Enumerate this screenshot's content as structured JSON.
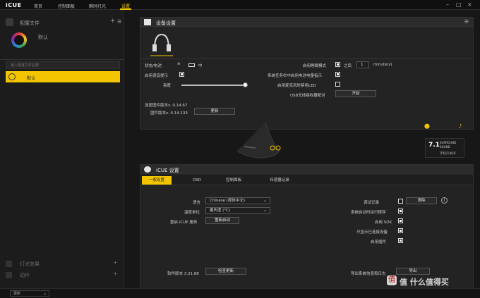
{
  "app": {
    "logo": "iCUE"
  },
  "nav": {
    "items": [
      "首页",
      "控制面板",
      "瞬时灯光",
      "设置"
    ],
    "active_index": 3
  },
  "window": {
    "minimize": "–",
    "maximize": "□",
    "close": "×"
  },
  "sidebar": {
    "header": "配置文件",
    "profile_name": "默认",
    "search_placeholder": "输入配置文件名称",
    "items": [
      {
        "label": "默认",
        "selected": true
      }
    ],
    "sections": [
      "灯光效果",
      "动作"
    ]
  },
  "bottom": {
    "update_label": "更新"
  },
  "device_panel": {
    "title": "设备设置",
    "status_label": "状态/电池",
    "battery_level": "中",
    "voice_prompt_label": "启用语音提示",
    "brightness_label": "亮度",
    "brightness_value": 1.0,
    "firmware_enc_label": "加密固件版本v. 0.14.67",
    "firmware_label": "固件版本v. 0.14.133",
    "update_button": "更新",
    "sleep_mode_label": "启用睡眠模式",
    "sleep_after": "之后",
    "sleep_value": "1",
    "sleep_unit": "minute(s)",
    "tray_battery_label": "系统任务栏中启用电池电量指示",
    "mic_mute_led_label": "启用麦克风时禁用LED",
    "usb_pair_label": "USB无线接收器配对",
    "pair_button": "开始",
    "surround_title": "7.1",
    "surround_line1": "SURROUND",
    "surround_line2": "SOUND",
    "surround_line3": "环绕声关闭"
  },
  "icue_panel": {
    "title": "iCUE 设置",
    "tabs": [
      "一般设置",
      "OSD",
      "控制面板",
      "传感器记录"
    ],
    "active_tab": 0,
    "language_label": "语言",
    "language_value": "Chinese (简体中文)",
    "temp_unit_label": "温度单位",
    "temp_unit_value": "摄氏度 (°C)",
    "restart_label": "重启 iCUE 服务",
    "restart_button": "重新启动",
    "debug_log_label": "调试记录",
    "clear_button": "清除",
    "startup_label": "系统启动时运行程序",
    "sdk_label": "启用 SDK",
    "show_connected_label": "只显示已连接设备",
    "plugins_label": "启用插件",
    "version_label": "软件版本 3.21.88",
    "check_update_button": "检查更新",
    "export_label": "导出系统信息和日志",
    "export_button": "导出",
    "checks": {
      "debug_log": false,
      "startup": true,
      "sdk": true,
      "show_connected": true,
      "plugins": true
    }
  },
  "watermark": {
    "text": "值 什么值得买",
    "badge": "值"
  },
  "colors": {
    "accent": "#f2c500",
    "bg": "#1a1a1a",
    "panel": "#232323"
  }
}
